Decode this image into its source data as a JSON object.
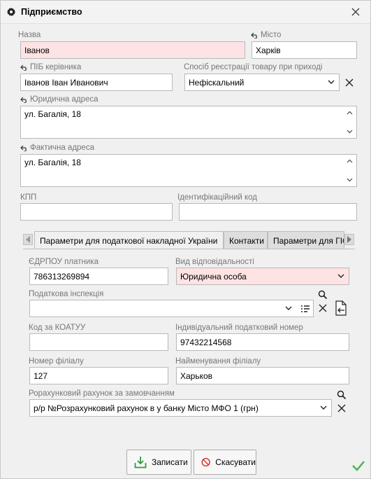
{
  "window": {
    "title": "Підприємство",
    "icons": {
      "title": "gear-icon",
      "close": "close-icon",
      "confirm": "checkmark-icon"
    }
  },
  "form": {
    "name": {
      "label": "Назва",
      "value": "Іванов"
    },
    "city": {
      "label": "Місто",
      "value": "Харків"
    },
    "director": {
      "label": "ПІБ керівника",
      "value": "Іванов Іван Иванович"
    },
    "registration_method": {
      "label": "Спосіб реєстрації товару при приході",
      "value": "Нефіскальний"
    },
    "legal_address": {
      "label": "Юридична адреса",
      "value": "ул. Багалія, 18"
    },
    "actual_address": {
      "label": "Фактична адреса",
      "value": "ул. Багалія, 18"
    },
    "kpp": {
      "label": "КПП",
      "value": ""
    },
    "id_code": {
      "label": "Ідентифікаційний код",
      "value": ""
    }
  },
  "tabs": [
    {
      "label": "Параметри для податкової накладної України",
      "active": true
    },
    {
      "label": "Контакти",
      "active": false
    },
    {
      "label": "Параметри для ГІС",
      "active": false
    }
  ],
  "tax": {
    "edrpou": {
      "label": "ЄДРПОУ платника",
      "value": "786313269894"
    },
    "liability_type": {
      "label": "Вид відповідальності",
      "value": "Юридична особа"
    },
    "tax_inspection": {
      "label": "Податкова інспекція",
      "value": ""
    },
    "koatuu": {
      "label": "Код за КОАТУУ",
      "value": ""
    },
    "individual_tax_number": {
      "label": "Індивідуальний податковий номер",
      "value": "97432214568"
    },
    "branch_number": {
      "label": "Номер філіалу",
      "value": "127"
    },
    "branch_name": {
      "label": "Найменування філіалу",
      "value": "Харьков"
    },
    "settlement_account": {
      "label": "Рорахунковий рахунок за замовчанням",
      "value": "р/р №Розрахунковий рахунок в у банку Місто МФО 1 (грн)"
    }
  },
  "buttons": {
    "save": "Записати",
    "cancel": "Скасувати"
  },
  "colors": {
    "required_field": "#fde3e3",
    "accent_green": "#2e9b3a",
    "cancel_red": "#d62020"
  }
}
